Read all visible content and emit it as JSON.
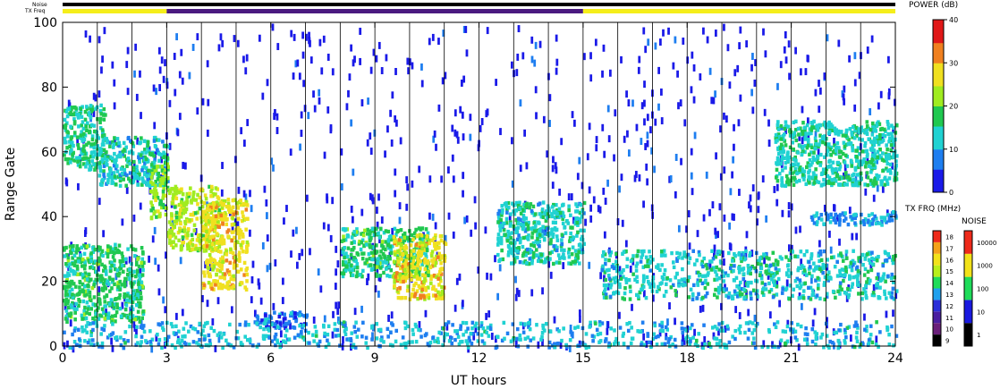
{
  "chart_data": [
    {
      "type": "heatmap",
      "title": "",
      "xlabel": "UT hours",
      "ylabel": "Range Gate",
      "xlim": [
        0,
        24
      ],
      "ylim": [
        0,
        100
      ],
      "x_ticks": [
        0,
        3,
        6,
        9,
        12,
        15,
        18,
        21,
        24
      ],
      "y_ticks": [
        0,
        20,
        40,
        60,
        80,
        100
      ],
      "x_tick_labels": [
        "0",
        "3",
        "6",
        "9",
        "12",
        "15",
        "18",
        "21",
        "24"
      ],
      "y_tick_labels": [
        "0",
        "20",
        "40",
        "60",
        "80",
        "100"
      ],
      "scan_boundaries_hours": [
        1,
        2,
        3,
        4,
        5,
        6,
        7,
        8,
        9,
        10,
        11,
        12,
        13,
        14,
        15,
        16,
        17,
        18,
        19,
        20,
        21,
        22,
        23
      ],
      "colorbar": {
        "label": "POWER (dB)",
        "min": 0,
        "max": 40,
        "ticks": [
          "0",
          "10",
          "20",
          "30",
          "40"
        ]
      },
      "echo_regions": [
        {
          "x": [
            0.0,
            1.2
          ],
          "y": [
            55,
            75
          ],
          "power_db": 14
        },
        {
          "x": [
            1.0,
            3.0
          ],
          "y": [
            50,
            65
          ],
          "power_db": 12
        },
        {
          "x": [
            2.5,
            3.0
          ],
          "y": [
            40,
            57
          ],
          "power_db": 22
        },
        {
          "x": [
            0.0,
            2.3
          ],
          "y": [
            8,
            32
          ],
          "power_db": 16
        },
        {
          "x": [
            3.0,
            4.5
          ],
          "y": [
            30,
            50
          ],
          "power_db": 24
        },
        {
          "x": [
            4.0,
            5.3
          ],
          "y": [
            18,
            46
          ],
          "power_db": 28
        },
        {
          "x": [
            5.5,
            7.0
          ],
          "y": [
            6,
            11
          ],
          "power_db": 5
        },
        {
          "x": [
            8.0,
            10.5
          ],
          "y": [
            22,
            37
          ],
          "power_db": 16
        },
        {
          "x": [
            9.5,
            11.0
          ],
          "y": [
            15,
            35
          ],
          "power_db": 28
        },
        {
          "x": [
            12.5,
            15.0
          ],
          "y": [
            26,
            45
          ],
          "power_db": 12
        },
        {
          "x": [
            15.5,
            24.0
          ],
          "y": [
            15,
            30
          ],
          "power_db": 12
        },
        {
          "x": [
            20.5,
            24.0
          ],
          "y": [
            50,
            70
          ],
          "power_db": 13
        },
        {
          "x": [
            21.5,
            24.0
          ],
          "y": [
            38,
            42
          ],
          "power_db": 8
        },
        {
          "x": [
            0.0,
            24.0
          ],
          "y": [
            0,
            8
          ],
          "power_db": 10
        }
      ]
    },
    {
      "type": "heatmap",
      "title": "",
      "colorbar": {
        "label": "TX FRQ (MHz)",
        "ticks": [
          "9",
          "10",
          "11",
          "12",
          "13",
          "14",
          "15",
          "16",
          "17",
          "18"
        ],
        "colors": [
          "#000000",
          "#6a1f7a",
          "#4a1ea0",
          "#2a2fd9",
          "#1fa0ee",
          "#1fdc5a",
          "#b8ef1a",
          "#f2e21a",
          "#f4a21a",
          "#ee2a1a"
        ]
      }
    },
    {
      "type": "heatmap",
      "title": "",
      "colorbar": {
        "label": "NOISE",
        "ticks": [
          "1",
          "10",
          "100",
          "1000",
          "10000"
        ],
        "colors": [
          "#000000",
          "#1a1ae0",
          "#1fdc5a",
          "#f2e21a",
          "#ee2a1a"
        ]
      }
    }
  ],
  "top_bars": {
    "noise_label": "Noise",
    "txfreq_label": "TX Freq",
    "noise_color": "#000000",
    "txfreq_segments": [
      {
        "start_hour": 0,
        "end_hour": 3,
        "color": "#f5ee1a"
      },
      {
        "start_hour": 3,
        "end_hour": 15,
        "color": "#4a1a80"
      },
      {
        "start_hour": 15,
        "end_hour": 24,
        "color": "#f5ee1a"
      }
    ]
  },
  "colors": {
    "power_scale": [
      "#1a1ae8",
      "#1e7ef0",
      "#20d2d2",
      "#20c850",
      "#a0ec20",
      "#f0e020",
      "#f08020",
      "#e01818"
    ]
  }
}
